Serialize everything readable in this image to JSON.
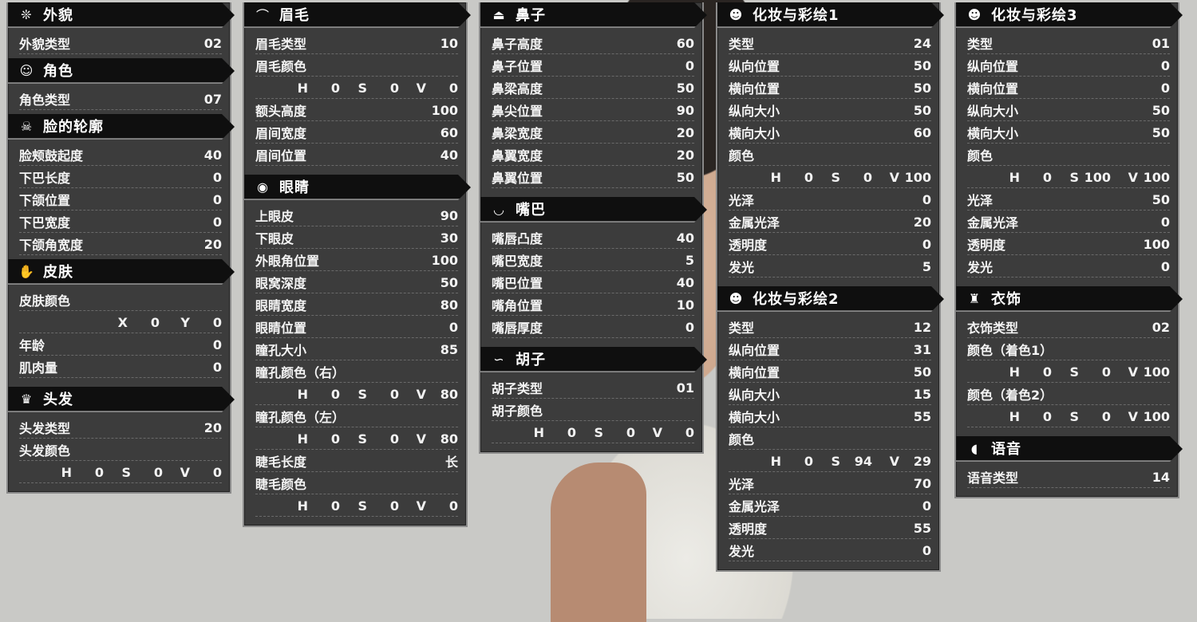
{
  "col1": {
    "appearance": {
      "title": "外貌",
      "icon": "snowflake-icon",
      "rows": [
        {
          "label": "外貌类型",
          "value": "02"
        }
      ]
    },
    "character": {
      "title": "角色",
      "icon": "portrait-icon",
      "rows": [
        {
          "label": "角色类型",
          "value": "07"
        }
      ]
    },
    "face": {
      "title": "脸的轮廓",
      "icon": "skull-icon",
      "rows": [
        {
          "label": "脸颊鼓起度",
          "value": "40"
        },
        {
          "label": "下巴长度",
          "value": "0"
        },
        {
          "label": "下颌位置",
          "value": "0"
        },
        {
          "label": "下巴宽度",
          "value": "0"
        },
        {
          "label": "下颌角宽度",
          "value": "20"
        }
      ]
    },
    "skin": {
      "title": "皮肤",
      "icon": "hand-icon",
      "color_label": "皮肤颜色",
      "xy": {
        "x_label": "X",
        "x": "0",
        "y_label": "Y",
        "y": "0"
      },
      "rows": [
        {
          "label": "年龄",
          "value": "0"
        },
        {
          "label": "肌肉量",
          "value": "0"
        }
      ]
    },
    "hair": {
      "title": "头发",
      "icon": "hair-icon",
      "rows": [
        {
          "label": "头发类型",
          "value": "20"
        }
      ],
      "color_label": "头发颜色",
      "hsv": {
        "h": "0",
        "s": "0",
        "v": "0"
      }
    }
  },
  "col2": {
    "eyebrow": {
      "title": "眉毛",
      "icon": "eyebrow-icon",
      "rows": [
        {
          "label": "眉毛类型",
          "value": "10"
        }
      ],
      "color_label": "眉毛颜色",
      "hsv": {
        "h": "0",
        "s": "0",
        "v": "0"
      },
      "rows2": [
        {
          "label": "额头高度",
          "value": "100"
        },
        {
          "label": "眉间宽度",
          "value": "60"
        },
        {
          "label": "眉间位置",
          "value": "40"
        }
      ]
    },
    "eyes": {
      "title": "眼睛",
      "icon": "eye-icon",
      "rows": [
        {
          "label": "上眼皮",
          "value": "90"
        },
        {
          "label": "下眼皮",
          "value": "30"
        },
        {
          "label": "外眼角位置",
          "value": "100"
        },
        {
          "label": "眼窝深度",
          "value": "50"
        },
        {
          "label": "眼睛宽度",
          "value": "80"
        },
        {
          "label": "眼睛位置",
          "value": "0"
        },
        {
          "label": "瞳孔大小",
          "value": "85"
        }
      ],
      "pupil_right_label": "瞳孔颜色（右）",
      "pupil_right": {
        "h": "0",
        "s": "0",
        "v": "80"
      },
      "pupil_left_label": "瞳孔颜色（左）",
      "pupil_left": {
        "h": "0",
        "s": "0",
        "v": "80"
      },
      "lash_length_label": "睫毛长度",
      "lash_length": "长",
      "lash_color_label": "睫毛颜色",
      "lash_color": {
        "h": "0",
        "s": "0",
        "v": "0"
      }
    }
  },
  "col3": {
    "nose": {
      "title": "鼻子",
      "icon": "nose-icon",
      "rows": [
        {
          "label": "鼻子高度",
          "value": "60"
        },
        {
          "label": "鼻子位置",
          "value": "0"
        },
        {
          "label": "鼻梁高度",
          "value": "50"
        },
        {
          "label": "鼻尖位置",
          "value": "90"
        },
        {
          "label": "鼻梁宽度",
          "value": "20"
        },
        {
          "label": "鼻翼宽度",
          "value": "20"
        },
        {
          "label": "鼻翼位置",
          "value": "50"
        }
      ]
    },
    "mouth": {
      "title": "嘴巴",
      "icon": "lips-icon",
      "rows": [
        {
          "label": "嘴唇凸度",
          "value": "40"
        },
        {
          "label": "嘴巴宽度",
          "value": "5"
        },
        {
          "label": "嘴巴位置",
          "value": "40"
        },
        {
          "label": "嘴角位置",
          "value": "10"
        },
        {
          "label": "嘴唇厚度",
          "value": "0"
        }
      ]
    },
    "beard": {
      "title": "胡子",
      "icon": "mustache-icon",
      "rows": [
        {
          "label": "胡子类型",
          "value": "01"
        }
      ],
      "color_label": "胡子颜色",
      "hsv": {
        "h": "0",
        "s": "0",
        "v": "0"
      }
    }
  },
  "col4": {
    "makeup1": {
      "title": "化妆与彩绘1",
      "icon": "makeup1-icon",
      "rows": [
        {
          "label": "类型",
          "value": "24"
        },
        {
          "label": "纵向位置",
          "value": "50"
        },
        {
          "label": "横向位置",
          "value": "50"
        },
        {
          "label": "纵向大小",
          "value": "50"
        },
        {
          "label": "横向大小",
          "value": "60"
        }
      ],
      "color_label": "颜色",
      "hsv": {
        "h": "0",
        "s": "0",
        "v": "100"
      },
      "rows2": [
        {
          "label": "光泽",
          "value": "0"
        },
        {
          "label": "金属光泽",
          "value": "20"
        },
        {
          "label": "透明度",
          "value": "0"
        },
        {
          "label": "发光",
          "value": "5"
        }
      ]
    },
    "makeup2": {
      "title": "化妆与彩绘2",
      "icon": "makeup2-icon",
      "rows": [
        {
          "label": "类型",
          "value": "12"
        },
        {
          "label": "纵向位置",
          "value": "31"
        },
        {
          "label": "横向位置",
          "value": "50"
        },
        {
          "label": "纵向大小",
          "value": "15"
        },
        {
          "label": "横向大小",
          "value": "55"
        }
      ],
      "color_label": "颜色",
      "hsv": {
        "h": "0",
        "s": "94",
        "v": "29"
      },
      "rows2": [
        {
          "label": "光泽",
          "value": "70"
        },
        {
          "label": "金属光泽",
          "value": "0"
        },
        {
          "label": "透明度",
          "value": "55"
        },
        {
          "label": "发光",
          "value": "0"
        }
      ]
    }
  },
  "col5": {
    "makeup3": {
      "title": "化妆与彩绘3",
      "icon": "makeup3-icon",
      "rows": [
        {
          "label": "类型",
          "value": "01"
        },
        {
          "label": "纵向位置",
          "value": "0"
        },
        {
          "label": "横向位置",
          "value": "0"
        },
        {
          "label": "纵向大小",
          "value": "50"
        },
        {
          "label": "横向大小",
          "value": "50"
        }
      ],
      "color_label": "颜色",
      "hsv": {
        "h": "0",
        "s": "100",
        "v": "100"
      },
      "rows2": [
        {
          "label": "光泽",
          "value": "50"
        },
        {
          "label": "金属光泽",
          "value": "0"
        },
        {
          "label": "透明度",
          "value": "100"
        },
        {
          "label": "发光",
          "value": "0"
        }
      ]
    },
    "outfit": {
      "title": "衣饰",
      "icon": "armor-icon",
      "rows": [
        {
          "label": "衣饰类型",
          "value": "02"
        }
      ],
      "color1_label": "颜色（着色1）",
      "color1": {
        "h": "0",
        "s": "0",
        "v": "100"
      },
      "color2_label": "颜色（着色2）",
      "color2": {
        "h": "0",
        "s": "0",
        "v": "100"
      }
    },
    "voice": {
      "title": "语音",
      "icon": "voice-icon",
      "rows": [
        {
          "label": "语音类型",
          "value": "14"
        }
      ]
    }
  },
  "letters": {
    "h": "H",
    "s": "S",
    "v": "V"
  }
}
